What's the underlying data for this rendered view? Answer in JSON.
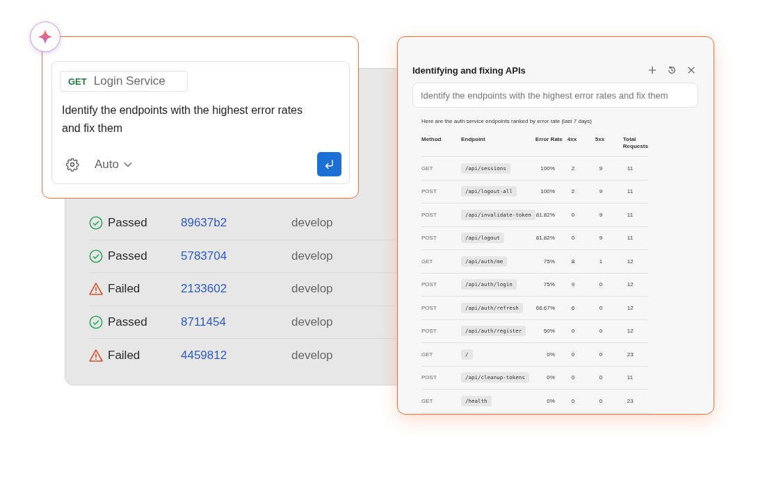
{
  "prompt_card": {
    "method": "GET",
    "service": "Login Service",
    "message": "Identify the endpoints with the highest error rates and fix them",
    "mode": "Auto"
  },
  "pipeline_runs": [
    {
      "kind": "passed",
      "status": "Passed",
      "commit": "89637b2",
      "branch": "develop"
    },
    {
      "kind": "passed",
      "status": "Passed",
      "commit": "5783704",
      "branch": "develop"
    },
    {
      "kind": "failed",
      "status": "Failed",
      "commit": "2133602",
      "branch": "develop"
    },
    {
      "kind": "passed",
      "status": "Passed",
      "commit": "8711454",
      "branch": "develop"
    },
    {
      "kind": "failed",
      "status": "Failed",
      "commit": "4459812",
      "branch": "develop"
    }
  ],
  "assistant_panel": {
    "title": "Identifying and fixing APIs",
    "query": {
      "placeholder": "Identify the endpoints with the highest error rates and fix them"
    },
    "intro": "Here are the auth service endpoints ranked by error rate (last 7 days)",
    "table": {
      "columns": [
        "Method",
        "Endpoint",
        "Error Rate",
        "4xx",
        "5xx",
        "Total Requests"
      ],
      "rows": [
        [
          "GET",
          "/api/sessions",
          "100%",
          "2",
          "9",
          "11"
        ],
        [
          "POST",
          "/api/logout-all",
          "100%",
          "2",
          "9",
          "11"
        ],
        [
          "POST",
          "/api/invalidate-token",
          "81.82%",
          "0",
          "9",
          "11"
        ],
        [
          "POST",
          "/api/logout",
          "81.82%",
          "0",
          "9",
          "11"
        ],
        [
          "GET",
          "/api/auth/me",
          "75%",
          "8",
          "1",
          "12"
        ],
        [
          "POST",
          "/api/auth/login",
          "75%",
          "9",
          "0",
          "12"
        ],
        [
          "POST",
          "/api/auth/refresh",
          "66.67%",
          "6",
          "0",
          "12"
        ],
        [
          "POST",
          "/api/auth/register",
          "50%",
          "0",
          "0",
          "12"
        ],
        [
          "GET",
          "/",
          "0%",
          "0",
          "0",
          "23"
        ],
        [
          "POST",
          "/api/cleanup-tokens",
          "0%",
          "0",
          "0",
          "11"
        ],
        [
          "GET",
          "/health",
          "0%",
          "0",
          "0",
          "23"
        ]
      ]
    }
  }
}
